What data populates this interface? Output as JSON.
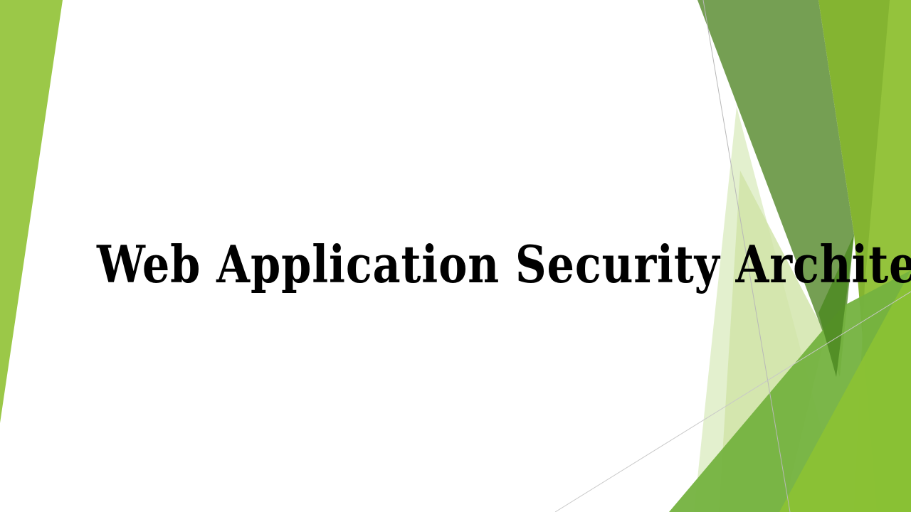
{
  "slide": {
    "title": "Web Application Security Architecture"
  },
  "theme": {
    "background": "#ffffff",
    "title_color": "#000000",
    "accent_light_green": "#9BC848",
    "accent_olive_green": "#6E9A4A",
    "accent_mid_green": "#84B431",
    "accent_pale_green": "#DCEBC0",
    "accent_dark_green": "#4E8A22"
  }
}
